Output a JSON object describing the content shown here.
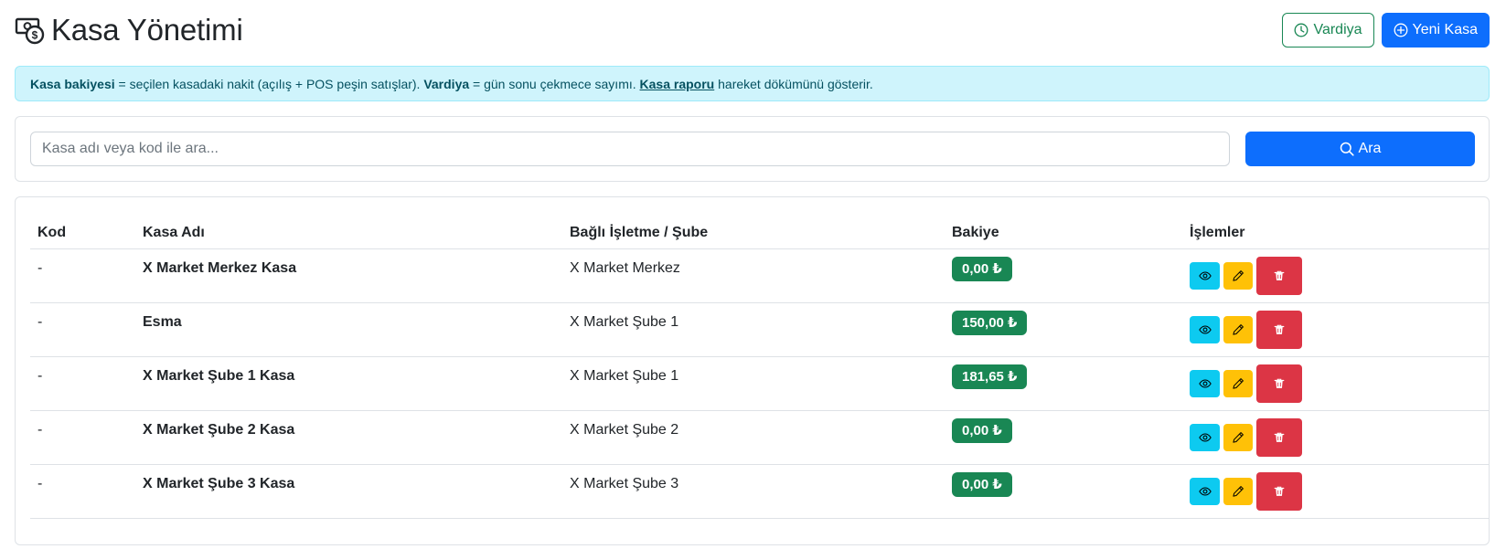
{
  "header": {
    "title": "Kasa Yönetimi",
    "title_icon": "cash-register-icon",
    "vardiya_label": "Vardiya",
    "new_label": "Yeni Kasa"
  },
  "alert": {
    "b1": "Kasa bakiyesi",
    "t1": " = seçilen kasadaki nakit (açılış + POS peşin satışlar). ",
    "b2": "Vardiya",
    "t2": " = gün sonu çekmece sayımı. ",
    "link": "Kasa raporu",
    "t3": " hareket dökümünü gösterir."
  },
  "search": {
    "placeholder": "Kasa adı veya kod ile ara...",
    "button_label": "Ara"
  },
  "table": {
    "columns": [
      "Kod",
      "Kasa Adı",
      "Bağlı İşletme / Şube",
      "Bakiye",
      "İşlemler"
    ],
    "rows": [
      {
        "kod": "-",
        "name": "X Market Merkez Kasa",
        "branch": "X Market Merkez",
        "balance": "0,00 ₺"
      },
      {
        "kod": "-",
        "name": "Esma",
        "branch": "X Market Şube 1",
        "balance": "150,00 ₺"
      },
      {
        "kod": "-",
        "name": "X Market Şube 1 Kasa",
        "branch": "X Market Şube 1",
        "balance": "181,65 ₺"
      },
      {
        "kod": "-",
        "name": "X Market Şube 2 Kasa",
        "branch": "X Market Şube 2",
        "balance": "0,00 ₺"
      },
      {
        "kod": "-",
        "name": "X Market Şube 3 Kasa",
        "branch": "X Market Şube 3",
        "balance": "0,00 ₺"
      }
    ]
  },
  "colors": {
    "primary": "#0d6efd",
    "success": "#198754",
    "info": "#0dcaf0",
    "warning": "#ffc107",
    "danger": "#dc3545"
  }
}
